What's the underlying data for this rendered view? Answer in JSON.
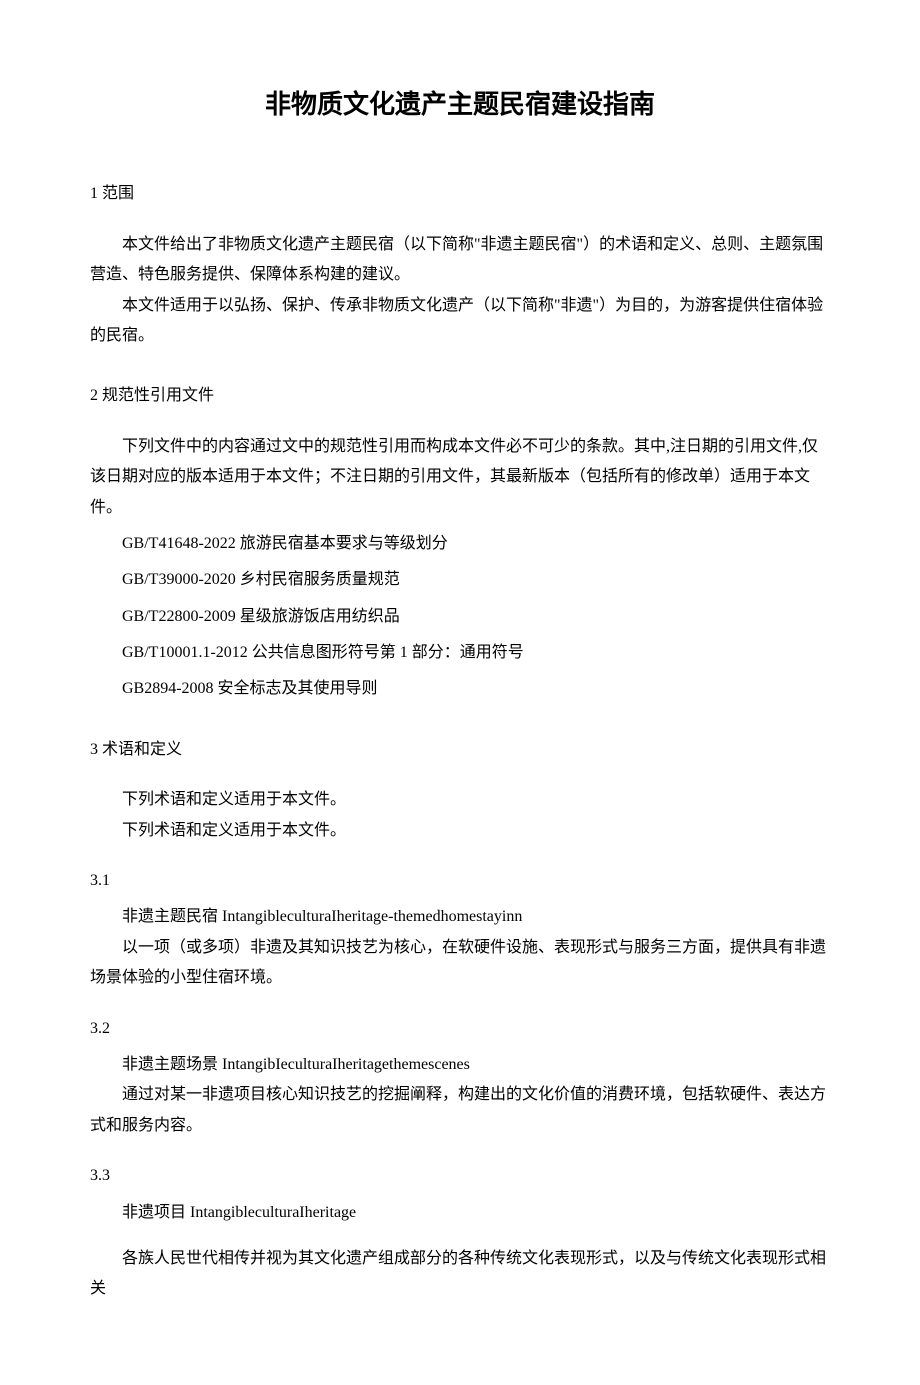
{
  "title": "非物质文化遗产主题民宿建设指南",
  "s1": {
    "heading": "1 范围",
    "p1": "本文件给出了非物质文化遗产主题民宿（以下简称\"非遗主题民宿\"）的术语和定义、总则、主题氛围营造、特色服务提供、保障体系构建的建议。",
    "p2": "本文件适用于以弘扬、保护、传承非物质文化遗产（以下简称\"非遗\"）为目的，为游客提供住宿体验的民宿。"
  },
  "s2": {
    "heading": "2 规范性引用文件",
    "p1": "下列文件中的内容通过文中的规范性引用而构成本文件必不可少的条款。其中,注日期的引用文件,仅该日期对应的版本适用于本文件；不注日期的引用文件，其最新版本（包括所有的修改单）适用于本文件。",
    "refs": [
      "GB/T41648-2022 旅游民宿基本要求与等级划分",
      "GB/T39000-2020 乡村民宿服务质量规范",
      "GB/T22800-2009 星级旅游饭店用纺织品",
      "GB/T10001.1-2012 公共信息图形符号第 1 部分：通用符号",
      "GB2894-2008 安全标志及其使用导则"
    ]
  },
  "s3": {
    "heading": "3 术语和定义",
    "p1": "下列术语和定义适用于本文件。",
    "p2": "下列术语和定义适用于本文件。",
    "t31": {
      "num": "3.1",
      "term": "非遗主题民宿 IntangibleculturaIheritage-themedhomestayinn",
      "def": "以一项（或多项）非遗及其知识技艺为核心，在软硬件设施、表现形式与服务三方面，提供具有非遗场景体验的小型住宿环境。"
    },
    "t32": {
      "num": "3.2",
      "term": "非遗主题场景 IntangibIeculturaIheritagethemescenes",
      "def": "通过对某一非遗项目核心知识技艺的挖掘阐释，构建出的文化价值的消费环境，包括软硬件、表达方式和服务内容。"
    },
    "t33": {
      "num": "3.3",
      "term": "非遗项目 IntangibleculturaIheritage",
      "def": "各族人民世代相传并视为其文化遗产组成部分的各种传统文化表现形式，以及与传统文化表现形式相关"
    }
  }
}
